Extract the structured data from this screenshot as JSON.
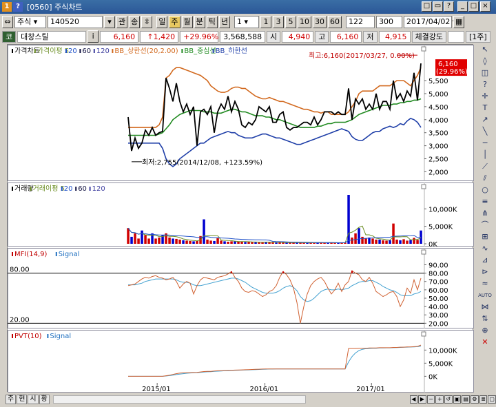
{
  "window": {
    "title": "[0560] 주식차트",
    "icons": [
      "app-icon",
      "help-icon"
    ],
    "controls": [
      "□",
      "▭",
      "?",
      "_",
      "□",
      "×"
    ]
  },
  "toolbar": {
    "market": "주식",
    "code": "140520",
    "btns_a": [
      "관",
      "송"
    ],
    "periods": [
      "일",
      "주",
      "월",
      "분",
      "틱",
      "년"
    ],
    "active_period": "주",
    "interval": "1",
    "quick_intervals": [
      "1",
      "3",
      "5",
      "10",
      "30",
      "60"
    ],
    "count": "122",
    "max": "300",
    "date": "2017/04/02"
  },
  "info": {
    "tag": "코",
    "name": "대창스틸",
    "i_btn": "i",
    "price": "6,160",
    "change": "↑1,420",
    "change_pct": "+29.96%",
    "volume": "3,568,588",
    "open_label": "시",
    "open": "4,940",
    "high_label": "고",
    "high": "6,160",
    "low_label": "저",
    "low": "4,915",
    "strength_label": "체결강도",
    "unit": "[1주]"
  },
  "bottom": {
    "tabs": [
      "주",
      "현",
      "시",
      "황"
    ]
  },
  "colors": {
    "bb_upper": "#d2691e",
    "bb_mid": "#228b22",
    "bb_lower": "#1f3fa8",
    "price": "#000000",
    "ma5": "#6b8e23",
    "ma20": "#1e50c8",
    "ma60": "#101040",
    "ma120": "#4040a0",
    "up": "#d00000",
    "down": "#0000d0"
  },
  "chart_data": [
    {
      "type": "line",
      "title": "",
      "legend": [
        "가격차트",
        "가격이평 5",
        "20",
        "60",
        "120",
        "BB_상한선(20,2.00)",
        "BB_중심선",
        "BB_하한선"
      ],
      "yticks": [
        "5,500",
        "5,000",
        "4,500",
        "4,000",
        "3,500",
        "3,000",
        "2,500",
        "2,000"
      ],
      "ylim": [
        1800,
        6400
      ],
      "max_note": "최고:6,160(2017/03/27, 0.00%)",
      "min_note": "최저:2,755(2014/12/08, +123.59%)",
      "price_box": [
        "6,160",
        "(29.96%)"
      ],
      "series": [
        {
          "key": "price",
          "values": [
            4100,
            2800,
            3300,
            2900,
            3100,
            3600,
            3400,
            3700,
            3400,
            3500,
            3550,
            5600,
            5200,
            4700,
            5400,
            4700,
            4300,
            4600,
            4200,
            4500,
            3000,
            4300,
            4400,
            4200,
            4500,
            3500,
            4300,
            4600,
            4400,
            4900,
            4300,
            4700,
            4400,
            3800,
            3700,
            3900,
            3800,
            4000,
            4500,
            4400,
            4300,
            4500,
            3900,
            3900,
            4200,
            4300,
            3700,
            3600,
            3700,
            3700,
            3800,
            3900,
            3900,
            3800,
            4100,
            3800,
            4000,
            4300,
            4300,
            4300,
            4200,
            4300,
            4200,
            4200,
            5200,
            4000,
            4800,
            4600,
            4800,
            4400,
            4600,
            4400,
            5000,
            4400,
            4700,
            4700,
            4400,
            5500,
            4800,
            5000,
            4700,
            5100,
            4900,
            5800,
            4740,
            6160
          ]
        },
        {
          "key": "bb_upper",
          "values": [
            3700,
            3700,
            3700,
            3700,
            3700,
            3700,
            3700,
            3700,
            3700,
            3800,
            4100,
            5600,
            5700,
            5900,
            6000,
            6000,
            5950,
            5900,
            5850,
            5800,
            5750,
            5700,
            5600,
            5500,
            5300,
            5200,
            5100,
            5050,
            5050,
            5100,
            5200,
            5250,
            5250,
            5200,
            5200,
            5100,
            5000,
            4900,
            4850,
            4800,
            4800,
            4850,
            4800,
            4750,
            4700,
            4700,
            4650,
            4600,
            4550,
            4500,
            4450,
            4400,
            4400,
            4350,
            4300,
            4300,
            4250,
            4300,
            4300,
            4200,
            4200,
            4200,
            4200,
            4200,
            4300,
            4500,
            4700,
            5000,
            5100,
            5100,
            5100,
            5100,
            5200,
            5300,
            5300,
            5300,
            5300,
            5400,
            5500,
            5500,
            5500,
            5400,
            5300,
            5500,
            5700,
            6000
          ]
        },
        {
          "key": "bb_mid",
          "values": [
            3400,
            3400,
            3400,
            3400,
            3400,
            3400,
            3400,
            3400,
            3400,
            3450,
            3500,
            3650,
            3800,
            4000,
            4100,
            4200,
            4250,
            4300,
            4350,
            4350,
            4350,
            4350,
            4300,
            4300,
            4300,
            4250,
            4250,
            4250,
            4300,
            4350,
            4400,
            4400,
            4350,
            4300,
            4300,
            4250,
            4200,
            4150,
            4150,
            4150,
            4100,
            4100,
            4050,
            4000,
            4000,
            3950,
            3900,
            3850,
            3800,
            3750,
            3700,
            3700,
            3700,
            3700,
            3700,
            3750,
            3750,
            3800,
            3850,
            3850,
            3900,
            3900,
            3900,
            3900,
            3950,
            4000,
            4100,
            4200,
            4250,
            4300,
            4350,
            4400,
            4450,
            4500,
            4550,
            4550,
            4550,
            4600,
            4600,
            4650,
            4650,
            4700,
            4700,
            4750,
            4750,
            4800
          ]
        },
        {
          "key": "bb_lower",
          "values": [
            3100,
            3100,
            3100,
            3100,
            3100,
            3100,
            3100,
            3100,
            3100,
            3100,
            2900,
            2500,
            2300,
            2200,
            2300,
            2500,
            2600,
            2700,
            2800,
            2900,
            3000,
            3100,
            3100,
            3200,
            3300,
            3350,
            3400,
            3450,
            3500,
            3550,
            3500,
            3500,
            3400,
            3350,
            3300,
            3300,
            3300,
            3350,
            3400,
            3450,
            3450,
            3400,
            3350,
            3300,
            3300,
            3250,
            3200,
            3150,
            3100,
            3050,
            3050,
            3100,
            3150,
            3200,
            3250,
            3300,
            3350,
            3400,
            3450,
            3500,
            3550,
            3600,
            3650,
            3600,
            3550,
            3350,
            3250,
            3200,
            3200,
            3300,
            3400,
            3500,
            3550,
            3550,
            3650,
            3700,
            3750,
            3700,
            3750,
            3850,
            3800,
            3950,
            4050,
            4000,
            3900,
            3700
          ]
        }
      ]
    },
    {
      "type": "bar",
      "legend": [
        "거래량",
        "거래이평 5",
        "20",
        "60",
        "120"
      ],
      "yticks": [
        "10,000K",
        "5,000K",
        "0K"
      ],
      "ylim": [
        0,
        14000
      ],
      "values": [
        4500,
        2000,
        3000,
        1500,
        3800,
        2500,
        1500,
        3000,
        1500,
        1800,
        2500,
        3000,
        1800,
        1500,
        1400,
        1200,
        1000,
        900,
        800,
        700,
        800,
        2200,
        7000,
        1200,
        900,
        800,
        1600,
        900,
        700,
        600,
        700,
        800,
        600,
        600,
        500,
        500,
        500,
        450,
        450,
        400,
        600,
        450,
        400,
        350,
        400,
        350,
        300,
        400,
        300,
        300,
        300,
        300,
        300,
        300,
        300,
        350,
        300,
        300,
        300,
        300,
        300,
        300,
        300,
        300,
        14000,
        1800,
        3000,
        4500,
        2000,
        1500,
        1800,
        1500,
        1200,
        1200,
        1000,
        900,
        1000,
        5800,
        1200,
        1000,
        1300,
        900,
        1100,
        1700,
        1100,
        3800
      ]
    },
    {
      "type": "line",
      "legend": [
        "MFI(14,9)",
        "Signal"
      ],
      "yticks": [
        "90.00",
        "80.00",
        "70.00",
        "60.00",
        "50.00",
        "40.00",
        "30.00",
        "20.00"
      ],
      "ylim": [
        17,
        97
      ],
      "levels": [
        "80.00",
        "20.00"
      ],
      "series": [
        {
          "key": "mfi",
          "values": [
            65,
            66,
            67,
            70,
            73,
            75,
            74,
            76,
            77,
            75,
            74,
            72,
            73,
            75,
            70,
            62,
            67,
            70,
            68,
            55,
            65,
            72,
            75,
            74,
            73,
            72,
            75,
            76,
            77,
            79,
            82,
            75,
            70,
            62,
            58,
            57,
            59,
            58,
            55,
            52,
            54,
            58,
            60,
            65,
            75,
            82,
            78,
            72,
            62,
            45,
            20,
            40,
            55,
            65,
            70,
            73,
            75,
            70,
            62,
            55,
            60,
            68,
            58,
            66,
            70,
            83,
            80,
            78,
            72,
            70,
            75,
            68,
            58,
            55,
            52,
            54,
            57,
            58,
            52,
            40,
            48,
            62,
            56,
            72,
            60,
            74
          ]
        },
        {
          "key": "signal",
          "values": [
            66,
            66,
            66,
            67,
            68,
            70,
            71,
            72,
            73,
            73,
            73,
            73,
            73,
            73,
            72,
            70,
            69,
            69,
            68,
            66,
            65,
            65,
            66,
            67,
            68,
            69,
            70,
            71,
            72,
            73,
            74,
            74,
            73,
            71,
            69,
            66,
            63,
            61,
            59,
            57,
            56,
            56,
            56,
            57,
            59,
            62,
            64,
            65,
            63,
            59,
            52,
            48,
            46,
            47,
            50,
            54,
            58,
            60,
            61,
            60,
            60,
            61,
            60,
            61,
            62,
            65,
            67,
            69,
            70,
            70,
            71,
            71,
            69,
            67,
            64,
            62,
            60,
            59,
            57,
            54,
            53,
            53,
            53,
            55,
            56,
            58
          ]
        }
      ]
    },
    {
      "type": "line",
      "legend": [
        "PVT(10)",
        "Signal"
      ],
      "yticks": [
        "10,000K",
        "5,000K",
        "0K"
      ],
      "ylim": [
        -2000,
        13500
      ],
      "xticks": [
        "2015/01",
        "2016/01",
        "2017/01"
      ],
      "series": [
        {
          "key": "pvt",
          "values": [
            0,
            0,
            0,
            0,
            0,
            0,
            0,
            0,
            0,
            0,
            0,
            200,
            400,
            700,
            1000,
            1200,
            1300,
            1350,
            1400,
            1450,
            1500,
            1650,
            1800,
            1850,
            1900,
            2000,
            2100,
            2150,
            2200,
            2250,
            2300,
            2350,
            2400,
            2450,
            2500,
            2550,
            2600,
            2650,
            2700,
            2750,
            2800,
            2800,
            2800,
            2800,
            2800,
            2800,
            2800,
            2800,
            2800,
            2800,
            2800,
            2800,
            2800,
            2800,
            2800,
            2800,
            2800,
            2800,
            2800,
            2800,
            2800,
            2800,
            2800,
            2800,
            10600,
            10600,
            10600,
            10700,
            10700,
            10700,
            10800,
            10800,
            10800,
            10900,
            10900,
            10900,
            10900,
            11000,
            11000,
            11100,
            11100,
            11200,
            11200,
            11300,
            11400,
            11900
          ]
        },
        {
          "key": "pvt_signal",
          "values": [
            0,
            0,
            0,
            0,
            0,
            0,
            0,
            0,
            0,
            0,
            0,
            100,
            250,
            450,
            650,
            850,
            1000,
            1150,
            1250,
            1350,
            1400,
            1500,
            1600,
            1700,
            1750,
            1850,
            1950,
            2000,
            2100,
            2150,
            2200,
            2250,
            2300,
            2350,
            2400,
            2450,
            2500,
            2550,
            2600,
            2650,
            2700,
            2750,
            2750,
            2800,
            2800,
            2800,
            2800,
            2800,
            2800,
            2800,
            2800,
            2800,
            2800,
            2800,
            2800,
            2800,
            2800,
            2800,
            2800,
            2800,
            2800,
            2800,
            2800,
            2800,
            5500,
            7500,
            8900,
            9800,
            10300,
            10500,
            10600,
            10700,
            10700,
            10800,
            10800,
            10850,
            10850,
            10900,
            10950,
            11000,
            11050,
            11100,
            11150,
            11200,
            11300,
            11500
          ]
        }
      ]
    }
  ]
}
